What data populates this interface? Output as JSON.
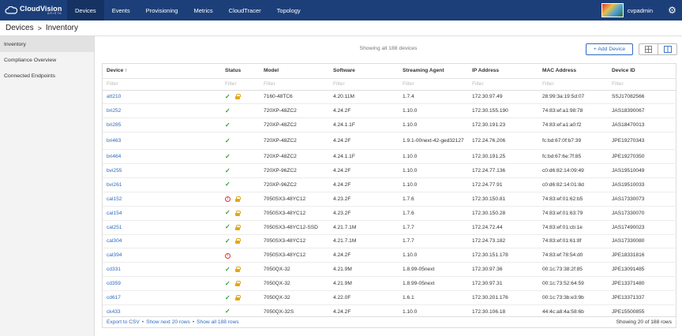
{
  "app": {
    "logo_main": "CloudVision",
    "logo_sub": "ARISTA",
    "tabs": [
      "Devices",
      "Events",
      "Provisioning",
      "Metrics",
      "CloudTracer",
      "Topology"
    ],
    "active_tab": "Devices",
    "user": "cvpadmin"
  },
  "breadcrumb": {
    "parent": "Devices",
    "separator": ">",
    "current": "Inventory"
  },
  "sidebar": {
    "items": [
      {
        "label": "Inventory",
        "active": true
      },
      {
        "label": "Compliance Overview",
        "active": false
      },
      {
        "label": "Connected Endpoints",
        "active": false
      }
    ]
  },
  "toolbar": {
    "showing_text": "Showing all 188 devices",
    "add_button": "+ Add Device"
  },
  "table": {
    "columns": [
      "Device ↑",
      "Status",
      "Model",
      "Software",
      "Streaming Agent",
      "IP Address",
      "MAC Address",
      "Device ID"
    ],
    "filter_placeholder": "Filter",
    "rows": [
      {
        "device": "att210",
        "status": "ok",
        "lock": true,
        "model": "7160-48TC6",
        "software": "4.20.11M",
        "agent": "1.7.4",
        "ip": "172.30.97.49",
        "mac": "28:99:3a:19:5d:07",
        "id": "SSJ17082566"
      },
      {
        "device": "bri252",
        "status": "ok",
        "lock": false,
        "model": "720XP-48ZC2",
        "software": "4.24.2F",
        "agent": "1.10.0",
        "ip": "172.30.155.190",
        "mac": "74:83:ef:a1:98:78",
        "id": "JAS18390067"
      },
      {
        "device": "bri285",
        "status": "ok",
        "lock": false,
        "model": "720XP-48ZC2",
        "software": "4.24.1.1F",
        "agent": "1.10.0",
        "ip": "172.30.191.23",
        "mac": "74:83:ef:a1:a0:f2",
        "id": "JAS18470013"
      },
      {
        "device": "bri463",
        "status": "ok",
        "lock": false,
        "model": "720XP-48ZC2",
        "software": "4.24.2F",
        "agent": "1.9.1-00next-42-ged32127",
        "ip": "172.24.76.206",
        "mac": "fc:bd:67:0f:b7:39",
        "id": "JPE19270343",
        "tall": true
      },
      {
        "device": "bri464",
        "status": "ok",
        "lock": false,
        "model": "720XP-48ZC2",
        "software": "4.24.1.1F",
        "agent": "1.10.0",
        "ip": "172.30.191.25",
        "mac": "fc:bd:67:6e:7f:85",
        "id": "JPE19270350"
      },
      {
        "device": "bvi255",
        "status": "ok",
        "lock": false,
        "model": "720XP-96ZC2",
        "software": "4.24.2F",
        "agent": "1.10.0",
        "ip": "172.24.77.136",
        "mac": "c0:d6:82:14:09:49",
        "id": "JAS19510049"
      },
      {
        "device": "bvi261",
        "status": "ok",
        "lock": false,
        "model": "720XP-96ZC2",
        "software": "4.24.2F",
        "agent": "1.10.0",
        "ip": "172.24.77.91",
        "mac": "c0:d6:82:14:01:8d",
        "id": "JAS19510033"
      },
      {
        "device": "cal152",
        "status": "err",
        "lock": true,
        "model": "7050SX3-48YC12",
        "software": "4.23.2F",
        "agent": "1.7.6",
        "ip": "172.30.150.81",
        "mac": "74:83:ef:01:62:b5",
        "id": "JAS17330073"
      },
      {
        "device": "cal154",
        "status": "ok",
        "lock": true,
        "model": "7050SX3-48YC12",
        "software": "4.23.2F",
        "agent": "1.7.6",
        "ip": "172.30.150.28",
        "mac": "74:83:ef:01:63:79",
        "id": "JAS17330070"
      },
      {
        "device": "cal251",
        "status": "ok",
        "lock": true,
        "model": "7050SX3-48YC12-SSD",
        "software": "4.21.7.1M",
        "agent": "1.7.7",
        "ip": "172.24.72.44",
        "mac": "74:83:ef:01:cb:1e",
        "id": "JAS17490023"
      },
      {
        "device": "cal304",
        "status": "ok",
        "lock": true,
        "model": "7050SX3-48YC12",
        "software": "4.21.7.1M",
        "agent": "1.7.7",
        "ip": "172.24.73.182",
        "mac": "74:83:ef:01:61:8f",
        "id": "JAS17330080"
      },
      {
        "device": "cal394",
        "status": "err",
        "lock": false,
        "model": "7050SX3-48YC12",
        "software": "4.24.2F",
        "agent": "1.10.0",
        "ip": "172.30.151.178",
        "mac": "74:83:ef:78:54:d0",
        "id": "JPE18331816"
      },
      {
        "device": "cd331",
        "status": "ok",
        "lock": true,
        "model": "7050QX-32",
        "software": "4.21.9M",
        "agent": "1.8.99-05next",
        "ip": "172.30.97.36",
        "mac": "00:1c:73:38:2f:85",
        "id": "JPE13091485"
      },
      {
        "device": "cd359",
        "status": "ok",
        "lock": true,
        "model": "7050QX-32",
        "software": "4.21.9M",
        "agent": "1.8.99-05next",
        "ip": "172.30.97.31",
        "mac": "00:1c:73:52:64:59",
        "id": "JPE13371480"
      },
      {
        "device": "cd617",
        "status": "ok",
        "lock": true,
        "model": "7050QX-32",
        "software": "4.22.0F",
        "agent": "1.6.1",
        "ip": "172.30.201.176",
        "mac": "00:1c:73:3b:e3:9b",
        "id": "JPE13371337"
      },
      {
        "device": "ck433",
        "status": "ok",
        "lock": false,
        "model": "7050QX-32S",
        "software": "4.24.2F",
        "agent": "1.10.0",
        "ip": "172.30.106.18",
        "mac": "44:4c:a8:4a:58:6b",
        "id": "JPE15500855"
      }
    ]
  },
  "footer": {
    "export": "Export to CSV",
    "next": "Show next 20 rows",
    "all": "Show all 188 rows",
    "showing": "Showing 20 of 188 rows"
  },
  "colors": {
    "nav_bg": "#1c3f7a",
    "link": "#2e6bc0",
    "ok": "#2f9a3a",
    "error": "#e03434",
    "lock": "#e0a81b"
  }
}
